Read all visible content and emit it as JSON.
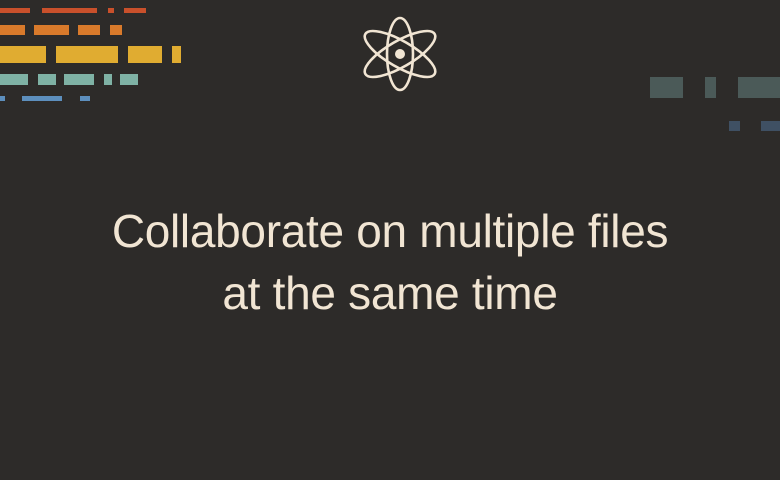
{
  "slide": {
    "headline_line_1": "Collaborate on multiple files",
    "headline_line_2": "at the same time"
  },
  "logo": {
    "icon": "atom-icon",
    "color": "#f1e5d3"
  },
  "palette": {
    "background": "#2d2b29",
    "text": "#f1e5d3",
    "red": "#c9502b",
    "orange": "#d97a2b",
    "yellow": "#e0ac31",
    "teal": "#7fb2a5",
    "blue": "#5d8fbd",
    "slate": "#4b5a58",
    "slate_blue": "#3f5063"
  }
}
